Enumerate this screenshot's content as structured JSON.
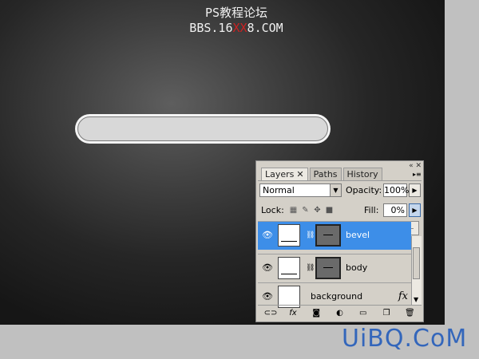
{
  "watermark_top": {
    "line1": "PS教程论坛",
    "line2_prefix": "BBS.16",
    "line2_red": "XX",
    "line2_suffix": "8.COM"
  },
  "panel": {
    "window_controls": "« ✕",
    "tabs": [
      {
        "label": "Layers",
        "close": "✕",
        "active": true
      },
      {
        "label": "Paths",
        "active": false
      },
      {
        "label": "History",
        "active": false
      }
    ],
    "blend_mode": "Normal",
    "opacity_label": "Opacity:",
    "opacity_value": "100%",
    "lock_label": "Lock:",
    "fill_label": "Fill:",
    "fill_value": "0%",
    "fill_slider_value_percent": 0,
    "layers": [
      {
        "name": "bevel",
        "selected": true,
        "visible": true
      },
      {
        "name": "body",
        "selected": false,
        "visible": true
      },
      {
        "name": "background",
        "selected": false,
        "visible": true,
        "fx": "fx"
      }
    ]
  },
  "colors": {
    "canvas_dark": "#161616",
    "canvas_center": "#5e5e5e",
    "selection": "#3d8ee8",
    "brand_blue": "#3366bb"
  },
  "logo": "UiBQ.CoM"
}
